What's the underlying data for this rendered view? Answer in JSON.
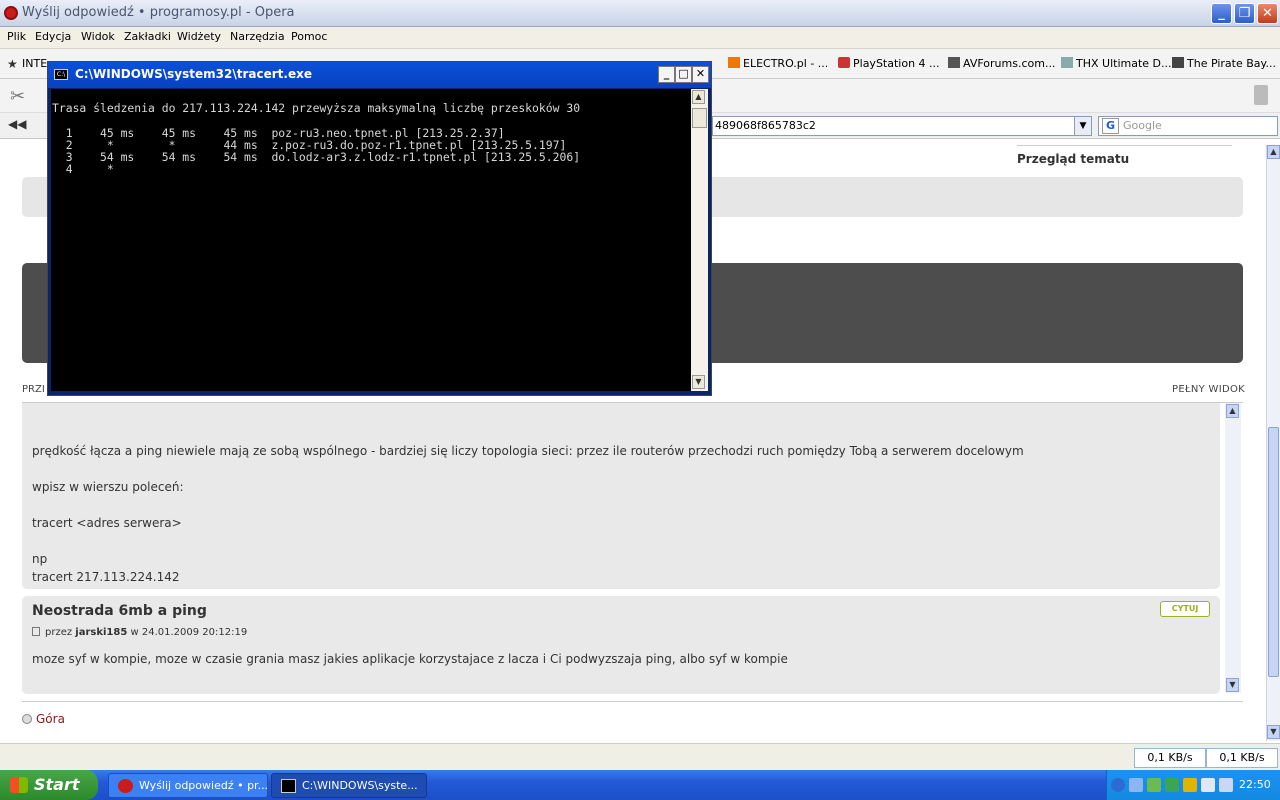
{
  "window": {
    "title": "Wyślij odpowiedź • programosy.pl - Opera"
  },
  "menubar": [
    "Plik",
    "Edycja",
    "Widok",
    "Zakładki",
    "Widżety",
    "Narzędzia",
    "Pomoc"
  ],
  "bookmarks": {
    "partial": "INTE",
    "items": [
      "ELECTRO.pl - ...",
      "PlayStation 4 ...",
      "AVForums.com...",
      "THX Ultimate D...",
      "The Pirate Bay..."
    ]
  },
  "address": {
    "url_fragment": "489068f865783c2",
    "search_placeholder": "Google"
  },
  "page": {
    "overview_label": "Przegląd tematu",
    "prev_label": "PRZI",
    "full_view": "PEŁNY WIDOK",
    "post1_lines": [
      "prędkość łącza a ping niewiele mają ze sobą wspólnego - bardziej się liczy topologia sieci: przez ile routerów przechodzi ruch pomiędzy Tobą a serwerem docelowym",
      "wpisz w wierszu poleceń:",
      "tracert <adres serwera>",
      "np",
      "tracert 217.113.224.142"
    ],
    "post2": {
      "title": "Neostrada 6mb a ping",
      "meta_prefix": "przez",
      "author": "jarski185",
      "meta_suffix": "w 24.01.2009 20:12:19",
      "body": "moze syf w kompie, moze w czasie grania masz jakies aplikacje korzystajace z lacza i Ci podwyzszaja ping, albo syf w kompie",
      "quote": "CYTUJ"
    },
    "top_link": "Góra"
  },
  "console": {
    "title": "C:\\WINDOWS\\system32\\tracert.exe",
    "header": "Trasa śledzenia do 217.113.224.142 przewyższa maksymalną liczbę przeskoków 30",
    "hops": [
      "  1    45 ms    45 ms    45 ms  poz-ru3.neo.tpnet.pl [213.25.2.37]",
      "  2     *        *       44 ms  z.poz-ru3.do.poz-r1.tpnet.pl [213.25.5.197]",
      "  3    54 ms    54 ms    54 ms  do.lodz-ar3.z.lodz-r1.tpnet.pl [213.25.5.206]",
      "  4     *"
    ]
  },
  "statusbar": {
    "down": "0,1 KB/s",
    "up": "0,1 KB/s"
  },
  "taskbar": {
    "start": "Start",
    "tasks": [
      "Wyślij odpowiedź • pr...",
      "C:\\WINDOWS\\syste..."
    ],
    "clock": "22:50"
  },
  "colors": {
    "xp_blue": "#2359d8",
    "console_bg": "#000000",
    "link": "#8b1a1a",
    "quote_green": "#9ab21c"
  }
}
